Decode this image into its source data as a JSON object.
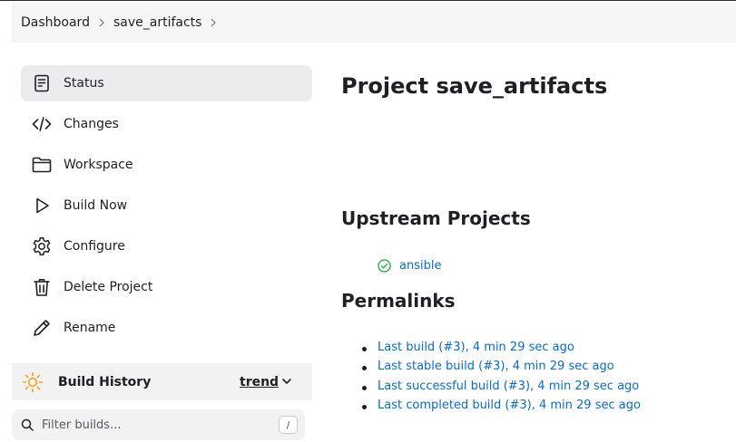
{
  "breadcrumb": {
    "items": [
      "Dashboard",
      "save_artifacts"
    ]
  },
  "sidebar": {
    "items": [
      {
        "label": "Status",
        "icon": "document-icon",
        "active": true
      },
      {
        "label": "Changes",
        "icon": "code-icon"
      },
      {
        "label": "Workspace",
        "icon": "folder-icon"
      },
      {
        "label": "Build Now",
        "icon": "play-icon"
      },
      {
        "label": "Configure",
        "icon": "gear-icon"
      },
      {
        "label": "Delete Project",
        "icon": "trash-icon"
      },
      {
        "label": "Rename",
        "icon": "pencil-icon"
      }
    ]
  },
  "build_history": {
    "title": "Build History",
    "trend_label": "trend",
    "icon": "sun-icon"
  },
  "filter": {
    "placeholder": "Filter builds...",
    "shortcut": "/"
  },
  "main": {
    "title": "Project save_artifacts",
    "upstream_title": "Upstream Projects",
    "upstream_items": [
      {
        "name": "ansible",
        "status": "success"
      }
    ],
    "permalinks_title": "Permalinks",
    "permalinks": [
      "Last build (#3), 4 min 29 sec ago",
      "Last stable build (#3), 4 min 29 sec ago",
      "Last successful build (#3), 4 min 29 sec ago",
      "Last completed build (#3), 4 min 29 sec ago"
    ]
  },
  "colors": {
    "link": "#0b6bcb",
    "success": "#1ea446",
    "sun": "#f2a41b",
    "active_bg": "#ececef"
  }
}
